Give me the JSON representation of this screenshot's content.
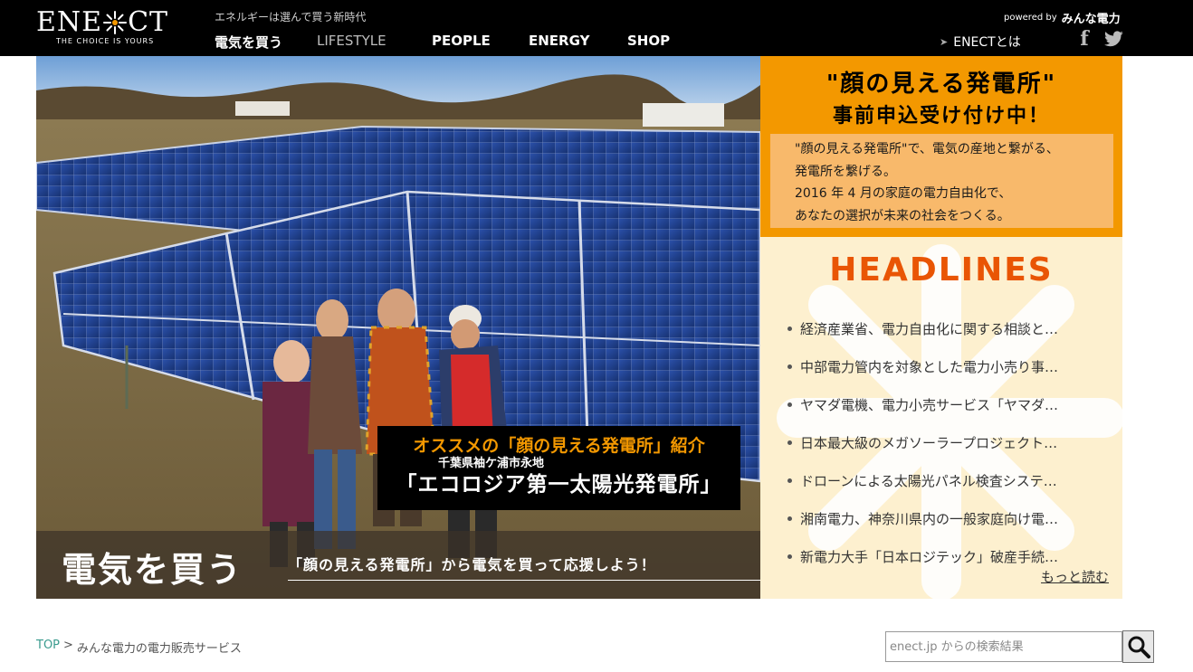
{
  "header": {
    "logo": {
      "wordmark_left": "ENE",
      "wordmark_right": "CT",
      "tagline": "THE CHOICE IS YOURS"
    },
    "tagline": "エネルギーは選んで買う新時代",
    "nav": [
      {
        "label": "電気を買う",
        "state": "active"
      },
      {
        "label": "LIFESTYLE",
        "state": "muted"
      },
      {
        "label": "PEOPLE",
        "state": "normal"
      },
      {
        "label": "ENERGY",
        "state": "normal"
      },
      {
        "label": "SHOP",
        "state": "normal"
      }
    ],
    "powered_by": {
      "prefix": "powered by",
      "brand": "みんな電力"
    },
    "about_link": "ENECTとは",
    "social": {
      "facebook_icon": "facebook-icon",
      "twitter_icon": "twitter-icon"
    }
  },
  "hero": {
    "feature": {
      "line1": "オススメの「顔の見える発電所」紹介",
      "line2": "千葉県袖ケ浦市永地",
      "line3": "「エコロジア第一太陽光発電所」"
    },
    "title": "電気を買う",
    "subtitle": "「顔の見える発電所」から電気を買って応援しよう！"
  },
  "promo": {
    "title1": "\"顔の見える発電所\"",
    "title2": "事前申込受け付け中！",
    "body": [
      "\"顔の見える発電所\"で、電気の産地と繋がる、",
      "発電所を繋げる。",
      "2016 年 4 月の家庭の電力自由化で、",
      "あなたの選択が未来の社会をつくる。"
    ]
  },
  "headlines": {
    "title": "HEADLINES",
    "items": [
      "経済産業省、電力自由化に関する相談と…",
      "中部電力管内を対象とした電力小売り事…",
      "ヤマダ電機、電力小売サービス「ヤマダ…",
      "日本最大級のメガソーラープロジェクト…",
      "ドローンによる太陽光パネル検査システ…",
      "湘南電力、神奈川県内の一般家庭向け電…",
      "新電力大手「日本ロジテック」破産手続…"
    ],
    "more": "もっと読む"
  },
  "breadcrumb": {
    "top": "TOP",
    "separator": ">",
    "current": "みんな電力の電力販売サービス"
  },
  "search": {
    "placeholder": "enect.jp からの検索結果",
    "value": "",
    "button_icon": "magnifier-icon"
  },
  "colors": {
    "header_bg": "#000000",
    "accent_orange": "#f39800",
    "headline_orange": "#e95504",
    "headlines_bg": "#fdf0cf",
    "breadcrumb_link": "#3a9b8e"
  }
}
